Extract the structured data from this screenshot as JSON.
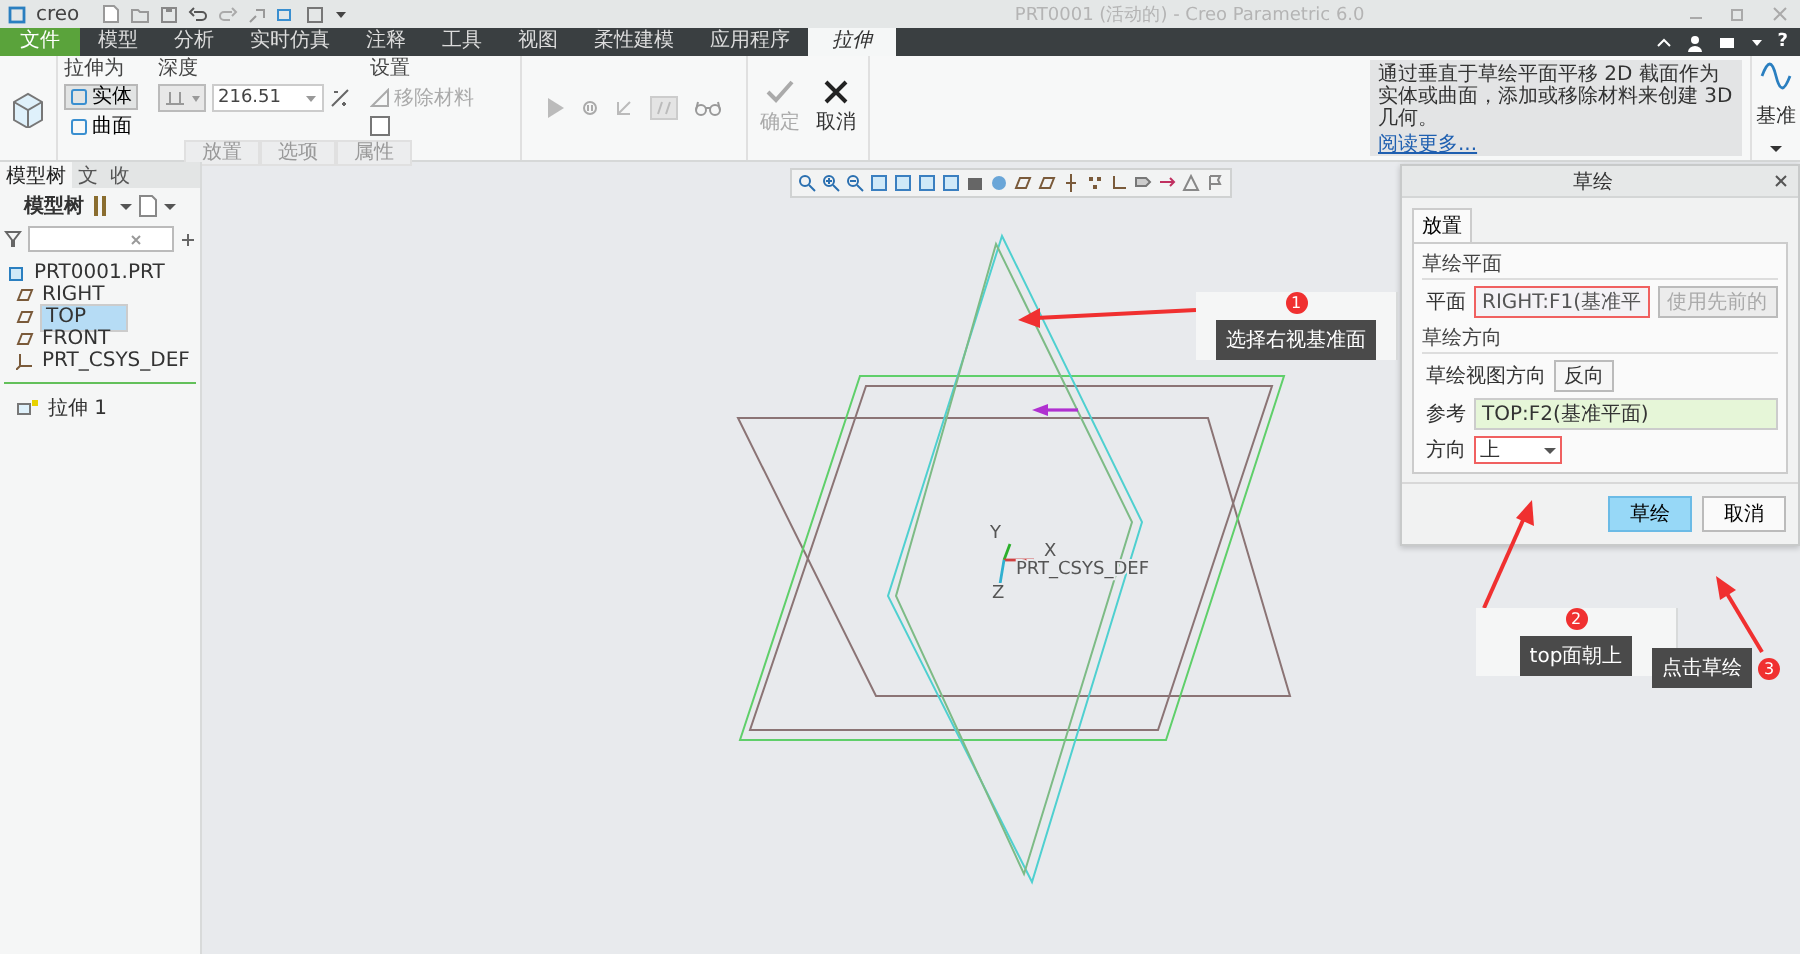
{
  "title_bar": {
    "logo": "creo",
    "title": "PRT0001 (活动的) - Creo Parametric 6.0"
  },
  "menu_tabs": [
    {
      "label": "文件",
      "kind": "file",
      "selected": false
    },
    {
      "label": "模型",
      "kind": "tab",
      "selected": false
    },
    {
      "label": "分析",
      "kind": "tab",
      "selected": false
    },
    {
      "label": "实时仿真",
      "kind": "tab",
      "selected": false
    },
    {
      "label": "注释",
      "kind": "tab",
      "selected": false
    },
    {
      "label": "工具",
      "kind": "tab",
      "selected": false
    },
    {
      "label": "视图",
      "kind": "tab",
      "selected": false
    },
    {
      "label": "柔性建模",
      "kind": "tab",
      "selected": false
    },
    {
      "label": "应用程序",
      "kind": "tab",
      "selected": false
    },
    {
      "label": "拉伸",
      "kind": "tab",
      "selected": true
    }
  ],
  "help_label": "?",
  "ribbon": {
    "extrude_as": {
      "label": "拉伸为",
      "options": [
        {
          "label": "实体",
          "selected": true
        },
        {
          "label": "曲面",
          "selected": false
        }
      ]
    },
    "depth": {
      "label": "深度",
      "value": "216.51"
    },
    "settings": {
      "label": "设置",
      "remove_material": {
        "label": "移除材料",
        "disabled": true
      },
      "checkbox_checked": false
    },
    "panels": [
      "放置",
      "选项",
      "属性"
    ],
    "actions": [
      {
        "label": "确定",
        "kind": "ok",
        "disabled": true
      },
      {
        "label": "取消",
        "kind": "cancel",
        "disabled": false
      }
    ],
    "help": {
      "text": "通过垂直于草绘平面平移 2D 截面作为实体或曲面，添加或移除材料来创建 3D 几何。",
      "link": "阅读更多..."
    },
    "datum": "基准"
  },
  "model_tree": {
    "tabs": [
      {
        "label": "模型树",
        "selected": true
      },
      {
        "label": "文",
        "selected": false
      },
      {
        "label": "收",
        "selected": false
      }
    ],
    "toolbar_label": "模型树",
    "items": [
      {
        "label": "PRT0001.PRT",
        "kind": "part",
        "selected": false,
        "children": [
          {
            "label": "RIGHT",
            "kind": "plane",
            "selected": false
          },
          {
            "label": "TOP",
            "kind": "plane",
            "selected": true
          },
          {
            "label": "FRONT",
            "kind": "plane",
            "selected": false
          },
          {
            "label": "PRT_CSYS_DEF",
            "kind": "csys",
            "selected": false
          }
        ]
      }
    ],
    "inserted_items": [
      {
        "label": "拉伸 1",
        "kind": "extrude",
        "selected": false
      }
    ]
  },
  "canvas": {
    "axes": [
      "Y",
      "X",
      "Z"
    ],
    "csys_label": "PRT_CSYS_DEF"
  },
  "sketch_dialog": {
    "title": "草绘",
    "tabs": [
      {
        "label": "放置",
        "selected": true
      }
    ],
    "plane_section": "草绘平面",
    "plane": {
      "label": "平面",
      "value": "RIGHT:F1(基准平",
      "highlighted": true
    },
    "use_previous": {
      "label": "使用先前的",
      "disabled": true
    },
    "orientation_section": "草绘方向",
    "view_direction_label": "草绘视图方向",
    "flip_button": "反向",
    "reference": {
      "label": "参考",
      "value": "TOP:F2(基准平面)",
      "highlighted": false
    },
    "direction": {
      "label": "方向",
      "value": "上",
      "highlighted": true
    },
    "buttons": [
      {
        "label": "草绘",
        "focused": true
      },
      {
        "label": "取消",
        "focused": false
      }
    ]
  },
  "callouts": [
    {
      "number": "1",
      "text": "选择右视基准面"
    },
    {
      "number": "2",
      "text": "top面朝上"
    },
    {
      "number": "3",
      "text": "点击草绘"
    }
  ]
}
